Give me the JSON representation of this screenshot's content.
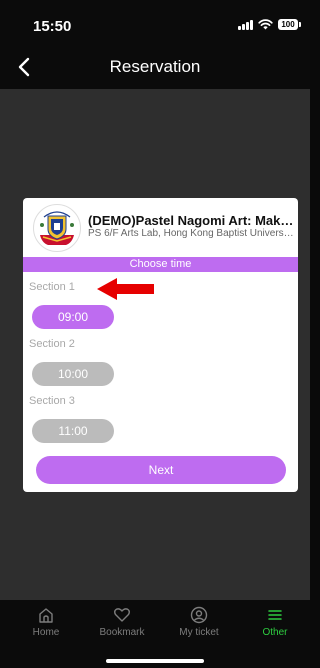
{
  "status_bar": {
    "time": "15:50",
    "battery": "100"
  },
  "header": {
    "title": "Reservation",
    "back_icon": "chevron-left-icon"
  },
  "dialog": {
    "event_title": "(DEMO)Pastel Nagomi Art: Making...",
    "event_venue": "PS 6/F Arts Lab, Hong Kong Baptist University...",
    "choose_time_label": "Choose time",
    "sections": [
      {
        "label": "Section 1",
        "time": "09:00",
        "state": "selected"
      },
      {
        "label": "Section 2",
        "time": "10:00",
        "state": "disabled"
      },
      {
        "label": "Section 3",
        "time": "11:00",
        "state": "disabled"
      }
    ],
    "next_label": "Next"
  },
  "tabbar": {
    "items": [
      {
        "label": "Home",
        "icon": "home-icon",
        "active": false
      },
      {
        "label": "Bookmark",
        "icon": "heart-icon",
        "active": false
      },
      {
        "label": "My ticket",
        "icon": "user-circle-icon",
        "active": false
      },
      {
        "label": "Other",
        "icon": "menu-icon",
        "active": true
      }
    ]
  },
  "colors": {
    "accent_purple": "#be6cf0",
    "disabled_gray": "#bbbbbb",
    "active_tab_green": "#2ecc40",
    "annotation_arrow_red": "#e60000"
  }
}
